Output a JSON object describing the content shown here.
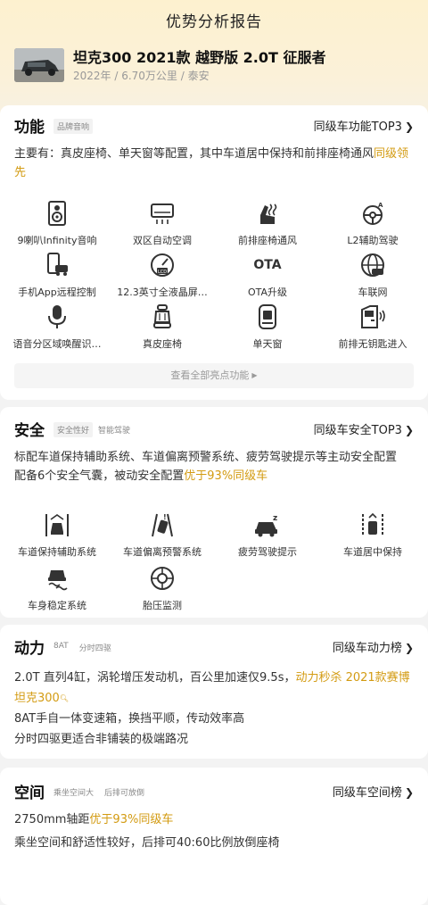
{
  "page_title": "优势分析报告",
  "car": {
    "name": "坦克300 2021款 越野版 2.0T 征服者",
    "meta": "2022年 / 6.70万公里 / 泰安"
  },
  "function": {
    "title": "功能",
    "tags": [
      "品牌音响"
    ],
    "rank": "同级车功能TOP3",
    "desc_prefix": "主要有：真皮座椅、单天窗等配置，其中车道居中保持和前排座椅通风",
    "desc_highlight": "同级领先",
    "items": [
      {
        "label": "9喇叭Infinity音响",
        "icon": "speaker-icon"
      },
      {
        "label": "双区自动空调",
        "icon": "air-conditioner-icon"
      },
      {
        "label": "前排座椅通风",
        "icon": "seat-ventilation-icon"
      },
      {
        "label": "L2辅助驾驶",
        "icon": "driver-assist-icon"
      },
      {
        "label": "手机App远程控制",
        "icon": "phone-car-icon"
      },
      {
        "label": "12.3英寸全液晶屏…",
        "icon": "lcd-gauge-icon"
      },
      {
        "label": "OTA升级",
        "icon": "ota-icon"
      },
      {
        "label": "车联网",
        "icon": "connected-car-icon"
      },
      {
        "label": "语音分区域唤醒识…",
        "icon": "microphone-icon"
      },
      {
        "label": "真皮座椅",
        "icon": "leather-seat-icon"
      },
      {
        "label": "单天窗",
        "icon": "sunroof-icon"
      },
      {
        "label": "前排无钥匙进入",
        "icon": "keyless-entry-icon"
      }
    ],
    "ota_text": "OTA",
    "view_all": "查看全部亮点功能"
  },
  "safety": {
    "title": "安全",
    "tags": [
      "安全性好",
      "智能驾驶"
    ],
    "rank": "同级车安全TOP3",
    "line1": "标配车道保持辅助系统、车道偏离预警系统、疲劳驾驶提示等主动安全配置",
    "line2_prefix": "配备6个安全气囊，被动安全配置",
    "line2_highlight": "优于93%同级车",
    "items": [
      {
        "label": "车道保持辅助系统",
        "icon": "lane-keep-icon"
      },
      {
        "label": "车道偏离预警系统",
        "icon": "lane-departure-icon"
      },
      {
        "label": "疲劳驾驶提示",
        "icon": "fatigue-alert-icon"
      },
      {
        "label": "车道居中保持",
        "icon": "lane-center-icon"
      },
      {
        "label": "车身稳定系统",
        "icon": "stability-icon"
      },
      {
        "label": "胎压监测",
        "icon": "tire-pressure-icon"
      }
    ]
  },
  "power": {
    "title": "动力",
    "tags": [
      "8AT",
      "分时四驱"
    ],
    "rank": "同级车动力榜",
    "line1_prefix": "2.0T 直列4缸，涡轮增压发动机，百公里加速仅9.5s，",
    "line1_highlight": "动力秒杀 2021款赛博坦克300",
    "line2": "8AT手自一体变速箱，换挡平顺，传动效率高",
    "line3": "分时四驱更适合非铺装的极端路况"
  },
  "space": {
    "title": "空间",
    "tags": [
      "乘坐空间大",
      "后排可放倒"
    ],
    "rank": "同级车空间榜",
    "line1_prefix": "2750mm轴距",
    "line1_highlight": "优于93%同级车",
    "line2": "乘坐空间和舒适性较好，后排可40:60比例放倒座椅"
  }
}
